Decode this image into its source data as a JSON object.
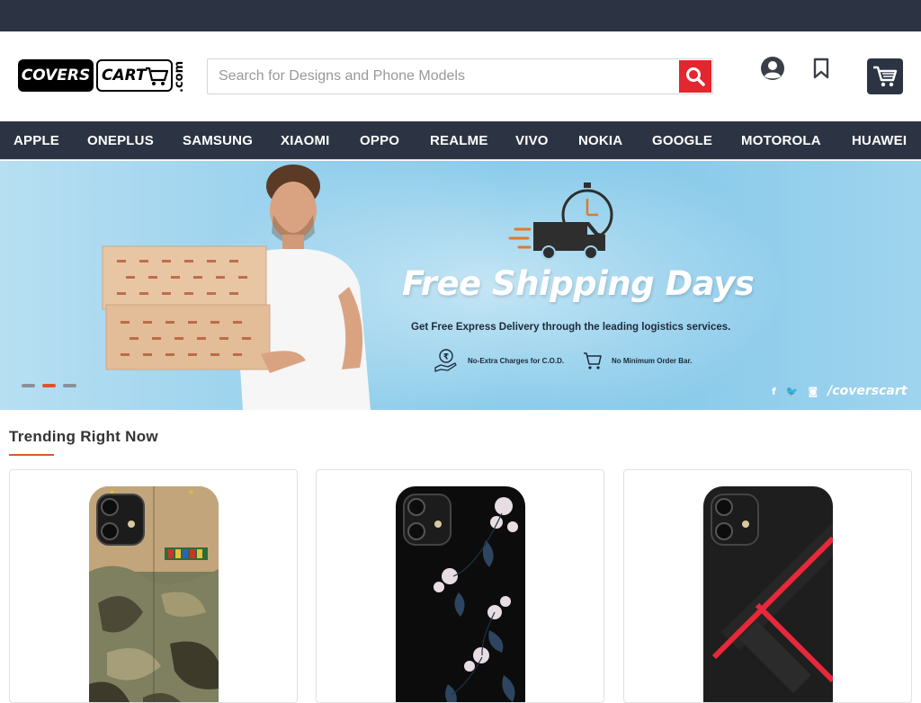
{
  "header": {
    "logo": {
      "part1": "COVERS",
      "part2": "CART",
      "suffix": ".com"
    },
    "search_placeholder": "Search for Designs and Phone Models",
    "icons": [
      "search-icon",
      "user-icon",
      "bookmark-icon",
      "cart-icon"
    ]
  },
  "nav": {
    "items": [
      "APPLE",
      "ONEPLUS",
      "SAMSUNG",
      "XIAOMI",
      "OPPO",
      "REALME",
      "VIVO",
      "NOKIA",
      "GOOGLE",
      "MOTOROLA",
      "HUAWEI"
    ]
  },
  "banner": {
    "title": "Free Shipping Days",
    "subtitle": "Get Free Express Delivery through the leading logistics services.",
    "features": [
      "No-Extra Charges for C.O.D.",
      "No Minimum Order Bar."
    ],
    "social_handle": "/coverscart",
    "slider": {
      "count": 3,
      "active": 2
    }
  },
  "trending": {
    "title": "Trending Right Now",
    "products": [
      {
        "design": "camouflage"
      },
      {
        "design": "dark-floral"
      },
      {
        "design": "red-stripes"
      }
    ]
  },
  "colors": {
    "nav_bg": "#2c3443",
    "accent": "#e0542b",
    "search_button": "#e4262e"
  }
}
